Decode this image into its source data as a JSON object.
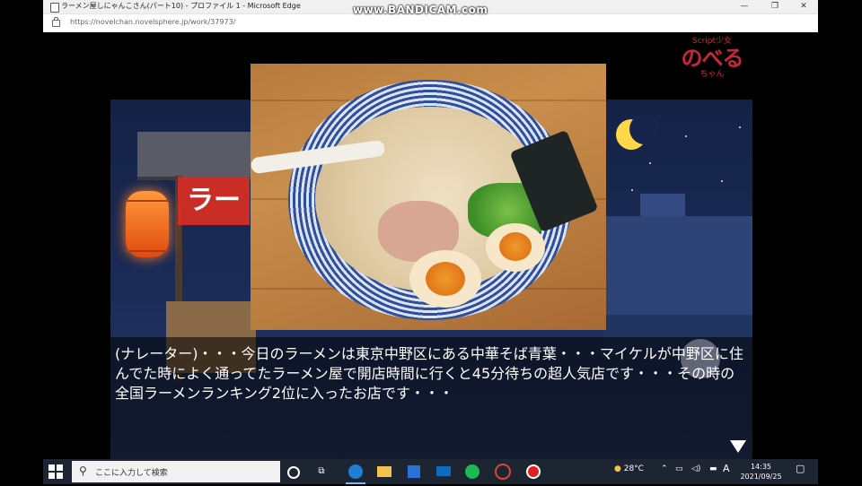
{
  "window": {
    "title": "ラーメン屋しにゃんこさん(パート10) - プロファイル 1 - Microsoft Edge",
    "url": "https://novelchan.novelsphere.jp/work/37973/",
    "controls": {
      "minimize": "—",
      "restore": "❐",
      "close": "✕"
    }
  },
  "watermark": "www.BANDICAM.com",
  "logo": {
    "sub": "Script少女",
    "main": "のべる",
    "small": "ちゃん"
  },
  "scene": {
    "noren_text": "ラー"
  },
  "narration": {
    "text": "(ナレーター)・・・今日のラーメンは東京中野区にある中華そば青葉・・・マイケルが中野区に住んでた時によく通ってたラーメン屋で開店時間に行くと45分待ちの超人気店です・・・その時の全国ラーメンランキング2位に入ったお店です・・・"
  },
  "taskbar": {
    "search_placeholder": "ここに入力して検索",
    "weather": "28°C",
    "ime": "A",
    "time": "14:35",
    "date": "2021/09/25",
    "colors": {
      "edge": "#1f7fd6",
      "explorer": "#f2c14e",
      "store": "#2a72d9",
      "mail": "#0f6cbd",
      "spotify": "#1db954",
      "app1": "#d84a2f",
      "record": "#e02020"
    }
  }
}
